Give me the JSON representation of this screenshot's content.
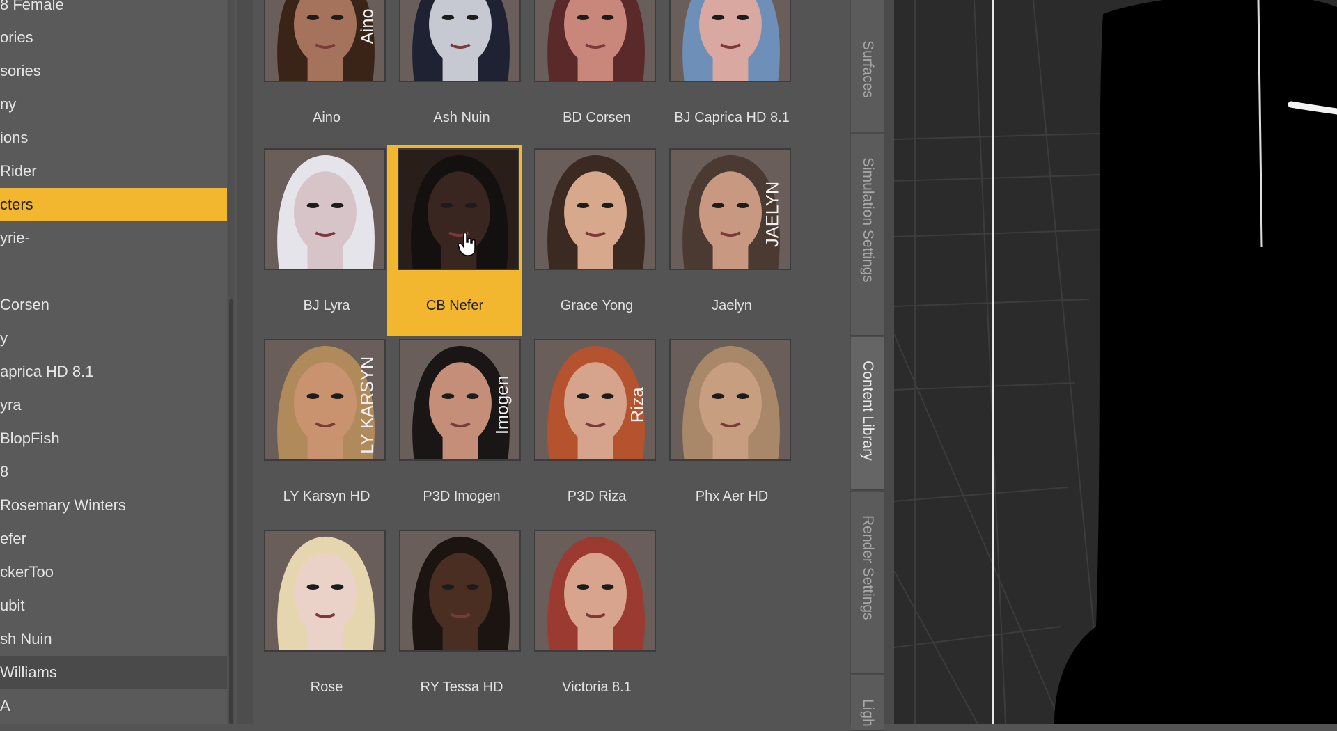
{
  "tree": {
    "items": [
      {
        "label": "8 Female",
        "state": "normal"
      },
      {
        "label": "ories",
        "state": "normal"
      },
      {
        "label": "sories",
        "state": "normal"
      },
      {
        "label": "ny",
        "state": "normal"
      },
      {
        "label": "ions",
        "state": "normal"
      },
      {
        "label": "Rider",
        "state": "normal"
      },
      {
        "label": "cters",
        "state": "selected"
      },
      {
        "label": "yrie-",
        "state": "normal"
      },
      {
        "label": "",
        "state": "normal"
      },
      {
        "label": "Corsen",
        "state": "normal"
      },
      {
        "label": "y",
        "state": "normal"
      },
      {
        "label": "aprica HD 8.1",
        "state": "normal"
      },
      {
        "label": "yra",
        "state": "normal"
      },
      {
        "label": "BlopFish",
        "state": "normal"
      },
      {
        "label": "8",
        "state": "normal"
      },
      {
        "label": "Rosemary Winters",
        "state": "normal"
      },
      {
        "label": "efer",
        "state": "normal"
      },
      {
        "label": "ckerToo",
        "state": "normal"
      },
      {
        "label": "ubit",
        "state": "normal"
      },
      {
        "label": "sh Nuin",
        "state": "normal"
      },
      {
        "label": "Williams",
        "state": "hover"
      },
      {
        "label": "A",
        "state": "normal"
      }
    ]
  },
  "grid": {
    "items": [
      {
        "name": "Aino",
        "thumb_text": "Aino",
        "tone": "#a5735c",
        "hair": "#3a2418"
      },
      {
        "name": "Ash Nuin",
        "thumb_text": "",
        "tone": "#c7c9d2",
        "hair": "#1f2233"
      },
      {
        "name": "BD Corsen",
        "thumb_text": "",
        "tone": "#c8877a",
        "hair": "#5a2a2a"
      },
      {
        "name": "BJ Caprica HD 8.1",
        "thumb_text": "",
        "tone": "#d9a8a0",
        "hair": "#6d8fb8"
      },
      {
        "name": "BJ Lyra",
        "thumb_text": "",
        "tone": "#d7c4c8",
        "hair": "#e4e4ea"
      },
      {
        "name": "CB Nefer",
        "thumb_text": "",
        "tone": "#3a2620",
        "hair": "#141010",
        "selected": true
      },
      {
        "name": "Grace Yong",
        "thumb_text": "",
        "tone": "#d8a88c",
        "hair": "#3a2a22"
      },
      {
        "name": "Jaelyn",
        "thumb_text": "JAELYN",
        "tone": "#c99880",
        "hair": "#4a3a32"
      },
      {
        "name": "LY Karsyn HD",
        "thumb_text": "LY KARSYN",
        "tone": "#c99370",
        "hair": "#b08a5a"
      },
      {
        "name": "P3D Imogen",
        "thumb_text": "Imogen",
        "tone": "#c48e78",
        "hair": "#1a1616"
      },
      {
        "name": "P3D Riza",
        "thumb_text": "Riza",
        "tone": "#d6a38c",
        "hair": "#b5532e"
      },
      {
        "name": "Phx Aer HD",
        "thumb_text": "",
        "tone": "#c79f80",
        "hair": "#a88868"
      },
      {
        "name": "Rose",
        "thumb_text": "",
        "tone": "#ead2c8",
        "hair": "#e6d6b0"
      },
      {
        "name": "RY Tessa HD",
        "thumb_text": "",
        "tone": "#4a2e22",
        "hair": "#1c1410"
      },
      {
        "name": "Victoria 8.1",
        "thumb_text": "",
        "tone": "#d9a48e",
        "hair": "#9a3a30"
      }
    ]
  },
  "tabs": [
    {
      "label": "Surfaces",
      "active": false
    },
    {
      "label": "Simulation Settings",
      "active": false
    },
    {
      "label": "Content Library",
      "active": true
    },
    {
      "label": "Render Settings",
      "active": false
    },
    {
      "label": "Ligh",
      "active": false
    }
  ]
}
